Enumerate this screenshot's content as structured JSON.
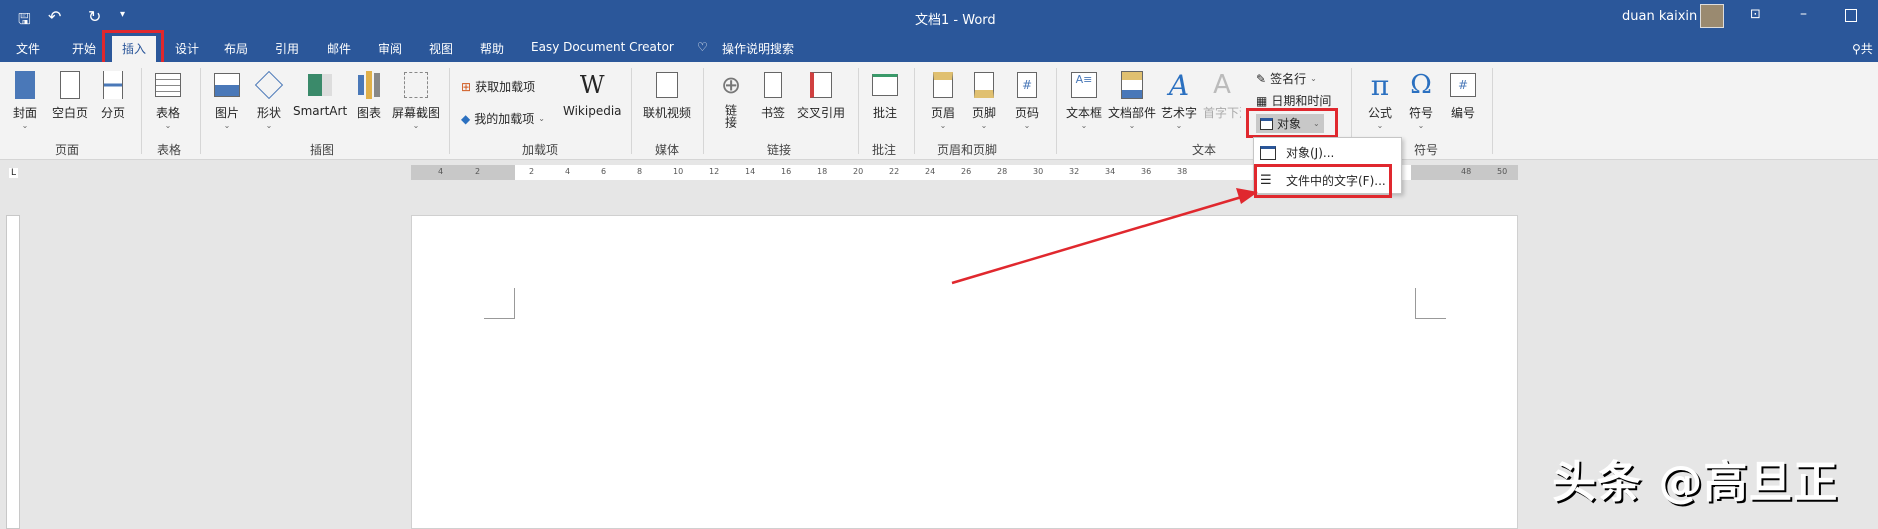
{
  "titlebar": {
    "title": "文档1 - Word",
    "user": "duan kaixin",
    "qat": [
      "save-icon",
      "undo-icon",
      "redo-icon",
      "customize-icon"
    ]
  },
  "tabs": [
    "文件",
    "开始",
    "插入",
    "设计",
    "布局",
    "引用",
    "邮件",
    "审阅",
    "视图",
    "帮助",
    "Easy Document Creator"
  ],
  "tell_me": "操作说明搜索",
  "share": "共",
  "ribbon": {
    "pages": {
      "cover": "封面",
      "blank": "空白页",
      "break": "分页",
      "group": "页面"
    },
    "tables": {
      "table": "表格",
      "group": "表格"
    },
    "illustrations": {
      "picture": "图片",
      "shapes": "形状",
      "smartart": "SmartArt",
      "chart": "图表",
      "screenshot": "屏幕截图",
      "group": "插图"
    },
    "addins": {
      "get": "获取加载项",
      "mine": "我的加载项",
      "wikipedia": "Wikipedia",
      "group": "加载项"
    },
    "media": {
      "video": "联机视频",
      "group": "媒体"
    },
    "links": {
      "link": "链接",
      "bookmark": "书签",
      "crossref": "交叉引用",
      "group": "链接"
    },
    "comments": {
      "comment": "批注",
      "group": "批注"
    },
    "headerfooter": {
      "header": "页眉",
      "footer": "页脚",
      "pagenum": "页码",
      "group": "页眉和页脚"
    },
    "text": {
      "textbox": "文本框",
      "quickparts": "文档部件",
      "wordart": "艺术字",
      "dropcap": "首字下沉",
      "sigline": "签名行",
      "datetime": "日期和时间",
      "object": "对象",
      "group": "文本"
    },
    "symbols": {
      "equation": "公式",
      "symbol": "符号",
      "number": "编号",
      "group": "符号"
    }
  },
  "menu": {
    "items": [
      "对象(J)...",
      "文件中的文字(F)..."
    ]
  },
  "ruler": [
    "4",
    "2",
    "2",
    "4",
    "6",
    "8",
    "10",
    "12",
    "14",
    "16",
    "18",
    "20",
    "22",
    "24",
    "26",
    "28",
    "30",
    "32",
    "34",
    "36",
    "38",
    "48",
    "50"
  ],
  "watermark": "头条 @高旦正"
}
